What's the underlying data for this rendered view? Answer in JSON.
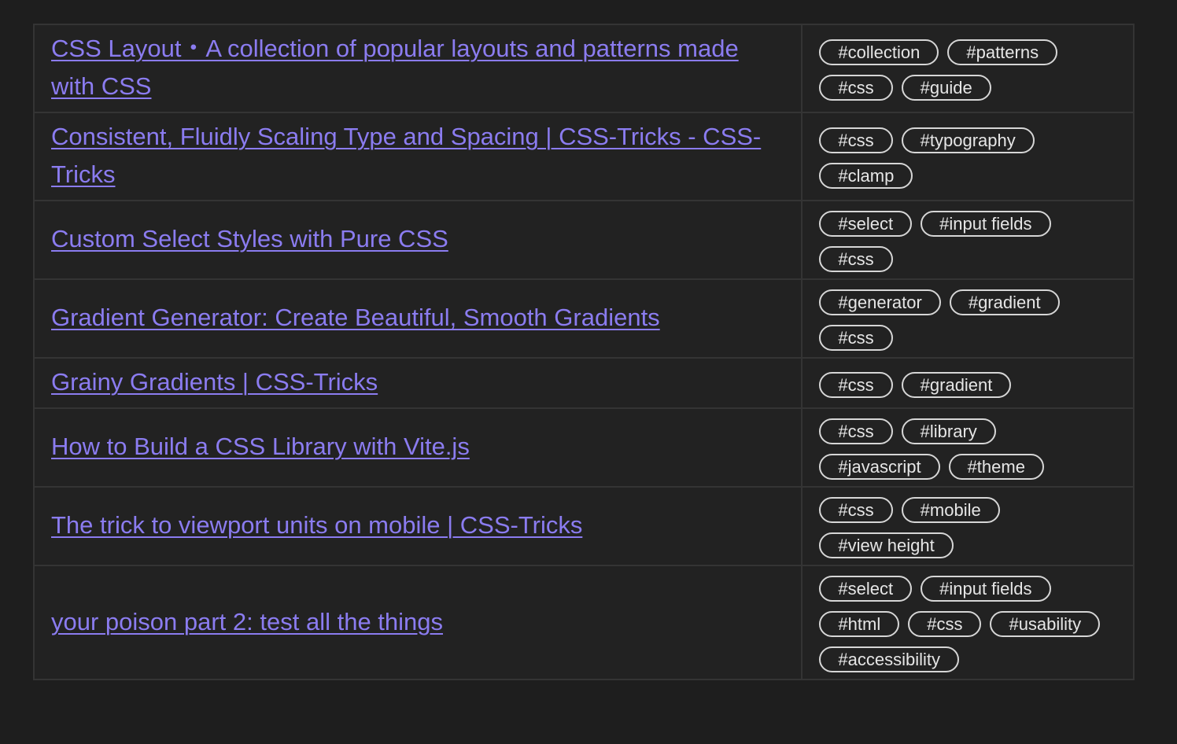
{
  "colors": {
    "background": "#1e1e1e",
    "table_background": "#222222",
    "border": "#343434",
    "link": "#8b7cf0",
    "tag_border": "#d6d6d6",
    "tag_text": "#e6e6e6"
  },
  "rows": [
    {
      "title": "CSS Layout・A collection of popular layouts and patterns made with CSS",
      "tags": [
        "#collection",
        "#patterns",
        "#css",
        "#guide"
      ]
    },
    {
      "title": "Consistent, Fluidly Scaling Type and Spacing | CSS-Tricks - CSS-Tricks",
      "tags": [
        "#css",
        "#typography",
        "#clamp"
      ]
    },
    {
      "title": "Custom Select Styles with Pure CSS",
      "tags": [
        "#select",
        "#input fields",
        "#css"
      ]
    },
    {
      "title": "Gradient Generator: Create Beautiful, Smooth Gradients",
      "tags": [
        "#generator",
        "#gradient",
        "#css"
      ]
    },
    {
      "title": "Grainy Gradients | CSS-Tricks",
      "tags": [
        "#css",
        "#gradient"
      ]
    },
    {
      "title": "How to Build a CSS Library with Vite.js",
      "tags": [
        "#css",
        "#library",
        "#javascript",
        "#theme"
      ]
    },
    {
      "title": "The trick to viewport units on mobile | CSS-Tricks",
      "tags": [
        "#css",
        "#mobile",
        "#view height"
      ]
    },
    {
      "title": "your poison part 2: test all the things",
      "tags": [
        "#select",
        "#input fields",
        "#html",
        "#css",
        "#usability",
        "#accessibility"
      ]
    }
  ]
}
